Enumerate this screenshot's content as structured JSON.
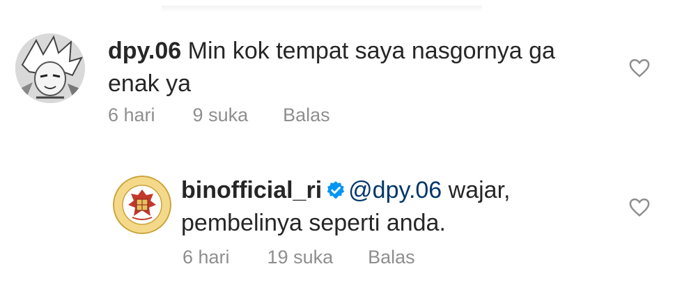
{
  "comments": [
    {
      "username": "dpy.06",
      "text": "Min kok tempat saya nasgornya ga enak ya",
      "time": "6 hari",
      "likes": "9 suka",
      "reply": "Balas",
      "avatar_icon": "anime-avatar"
    },
    {
      "username": "binofficial_ri",
      "verified": true,
      "mention": "@dpy.06",
      "text": " wajar, pembelinya seperti anda.",
      "time": "6 hari",
      "likes": "19 suka",
      "reply": "Balas",
      "avatar_icon": "bin-emblem"
    }
  ],
  "colors": {
    "text": "#262626",
    "meta": "#8e8e8e",
    "mention": "#00376b",
    "verified": "#0095f6"
  }
}
